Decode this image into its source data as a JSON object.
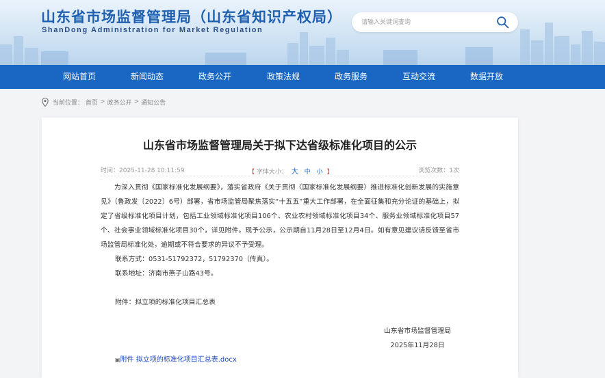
{
  "header": {
    "title": "山东省市场监督管理局（山东省知识产权局）",
    "subtitle": "ShanDong Administration for Market Regulation",
    "search_placeholder": "请输入关键词查询"
  },
  "nav": {
    "items": [
      {
        "label": "网站首页"
      },
      {
        "label": "新闻动态"
      },
      {
        "label": "政务公开"
      },
      {
        "label": "政策法规"
      },
      {
        "label": "政务服务"
      },
      {
        "label": "互动交流"
      },
      {
        "label": "数据开放"
      }
    ]
  },
  "breadcrumb": {
    "prefix": "当前位置：",
    "items": [
      "首页",
      "政务公开",
      "通知公告"
    ],
    "separator": ">"
  },
  "article": {
    "title": "山东省市场监督管理局关于拟下达省级标准化项目的公示",
    "time": "时间：2025-11-28 10:11:59",
    "font_size_label": "字体大小：",
    "font_sizes": [
      "大",
      "中",
      "小"
    ],
    "views": "浏览次数：1次",
    "paragraph": "为深入贯彻《国家标准化发展纲要》，落实省政府《关于贯彻〈国家标准化发展纲要〉推进标准化创新发展的实施意见》（鲁政发〔2022〕6号）部署，省市场监管局聚焦落实“十五五”重大工作部署，在全面征集和充分论证的基础上，拟定了省级标准化项目计划，包括工业领域标准化项目106个、农业农村领域标准化项目34个、服务业领域标准化项目57个、社会事业领域标准化项目30个，详见附件。现予公示，公示期自11月28日至12月4日。如有意见建议请反馈至省市场监管局标准化处，逾期或不符合要求的异议不予受理。",
    "contact_phone": "联系方式：0531-51792372，51792370（传真）。",
    "contact_address": "联系地址：济南市燕子山路43号。",
    "attachment_note": "附件：拟立项的标准化项目汇总表",
    "signature_org": "山东省市场监督管理局",
    "signature_date": "2025年11月28日",
    "attachment_link": "附件 拟立项的标准化项目汇总表.docx"
  },
  "colors": {
    "nav_bg": "#1a67c3",
    "title_blue": "#1f5fb0",
    "link_blue": "#1a47c3"
  }
}
